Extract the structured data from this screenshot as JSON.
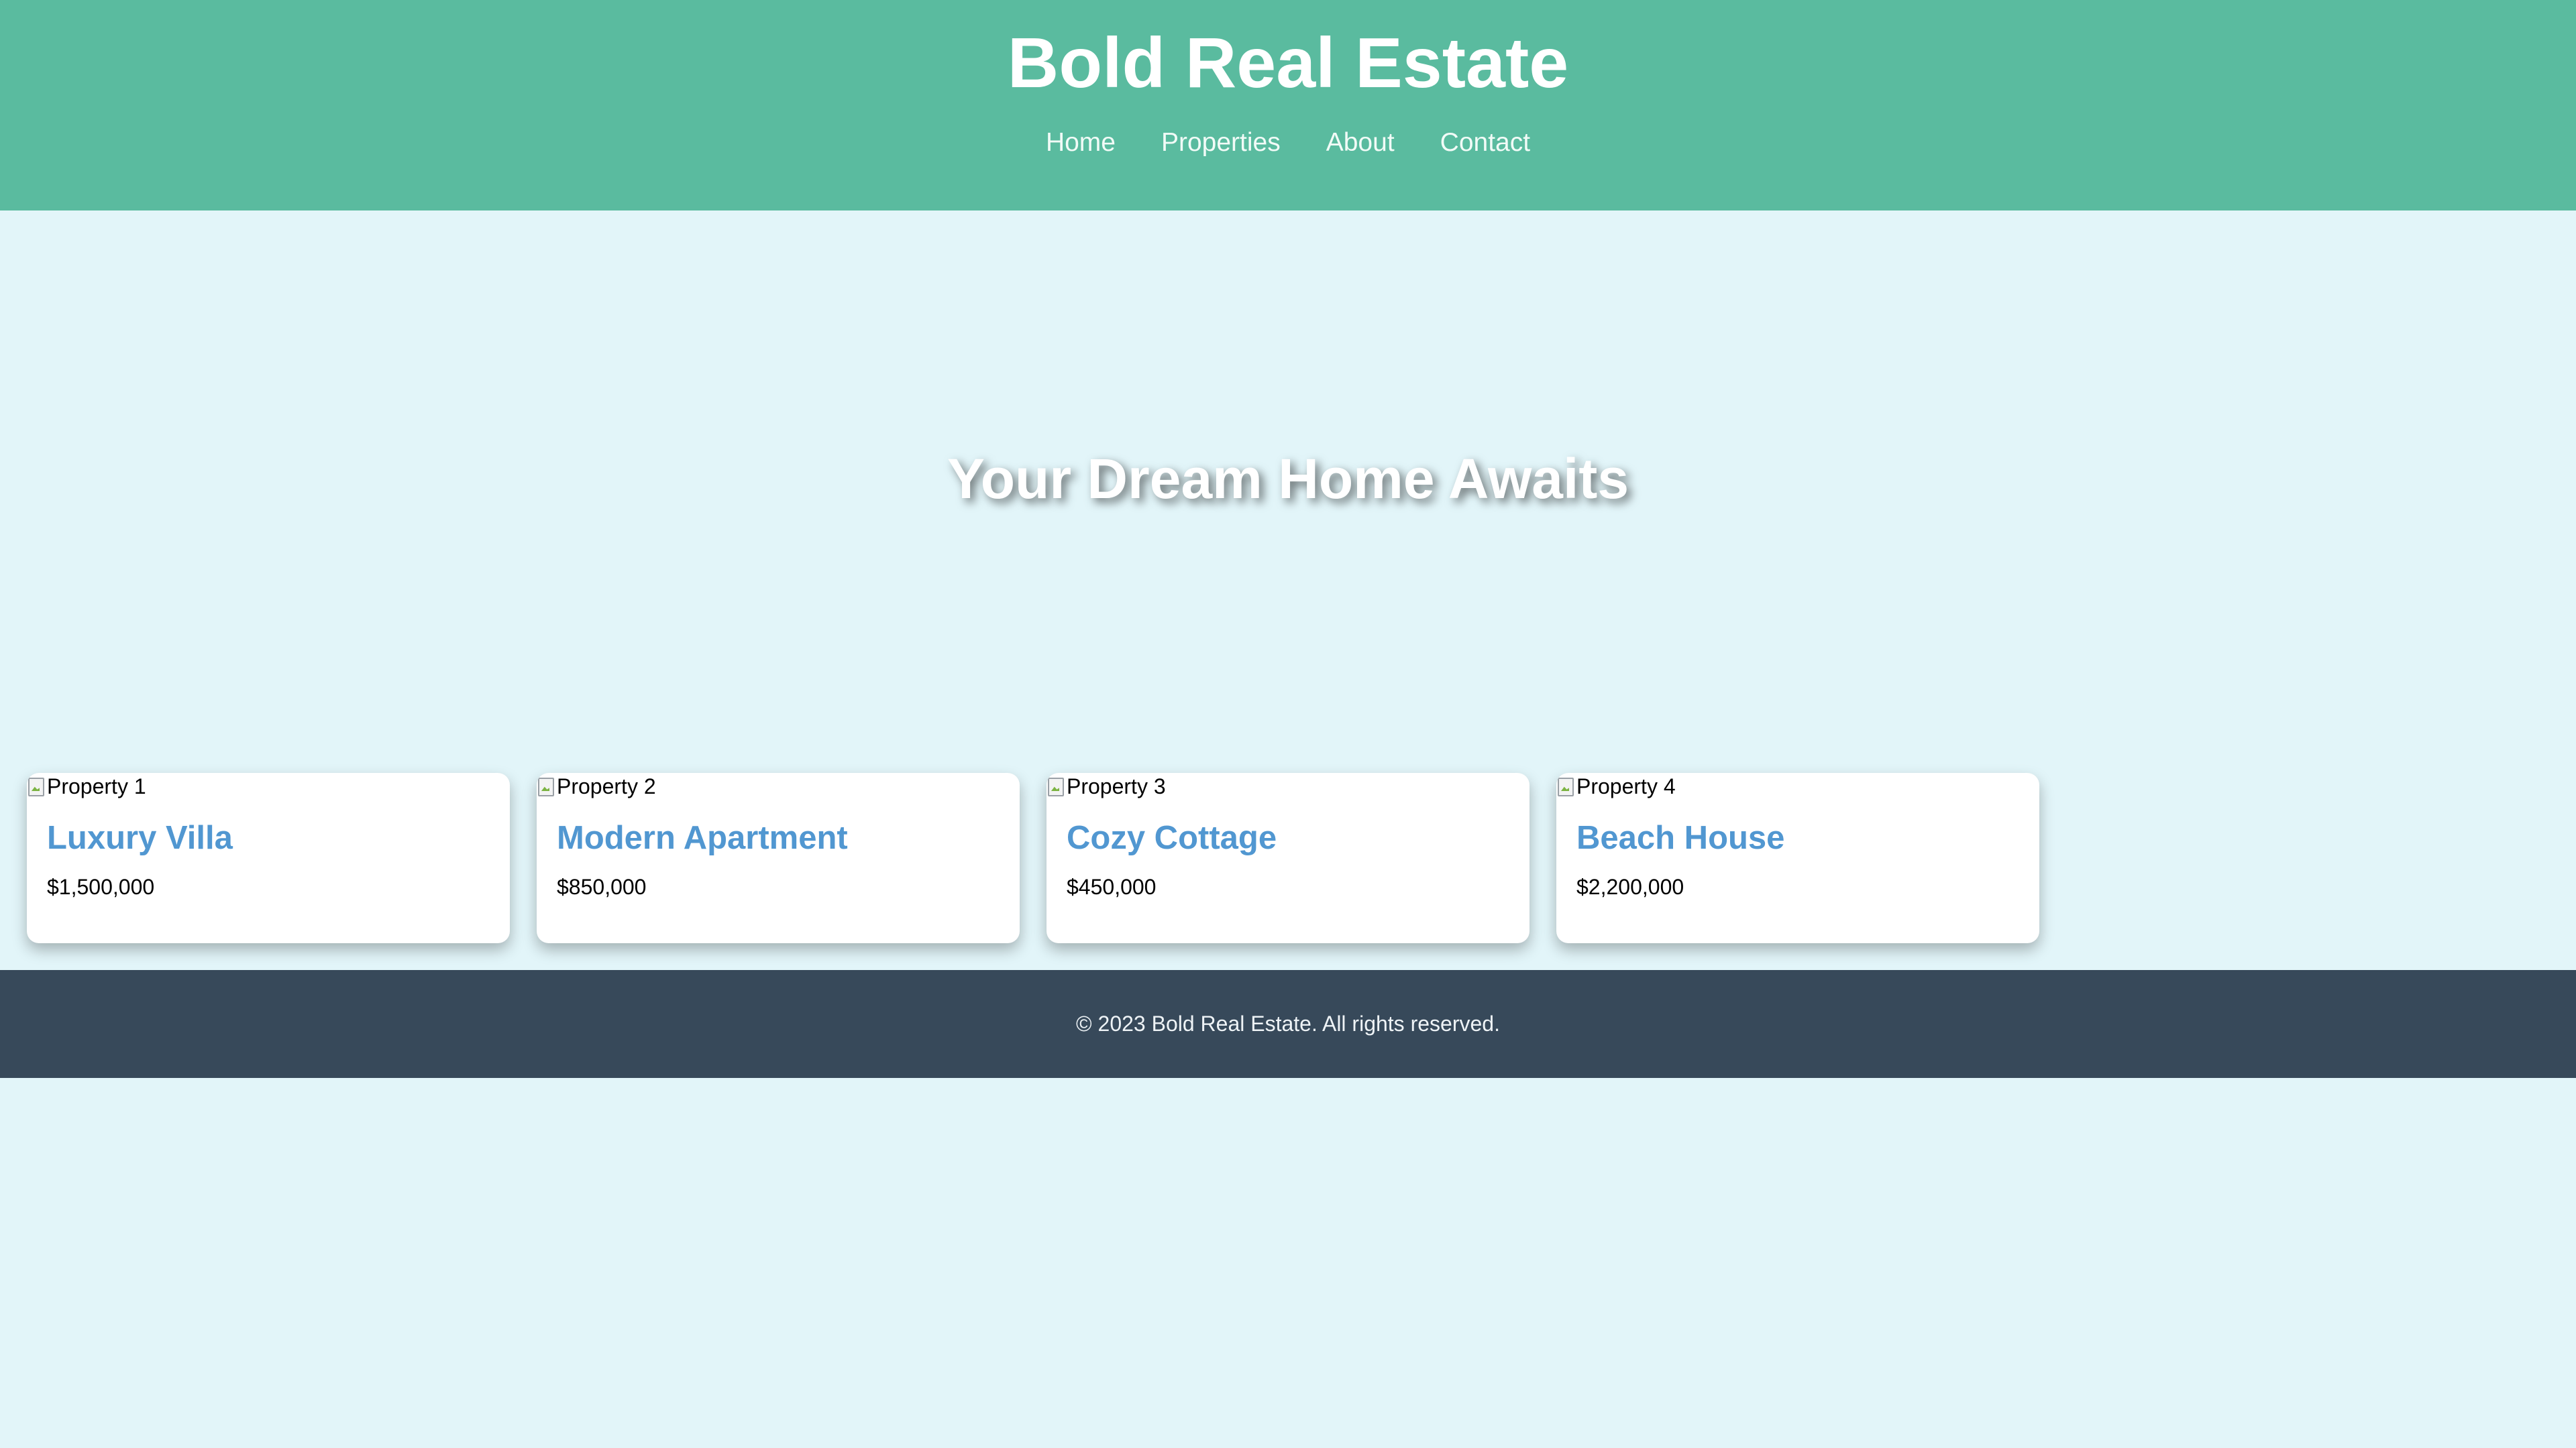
{
  "header": {
    "title": "Bold Real Estate",
    "nav": [
      {
        "label": "Home"
      },
      {
        "label": "Properties"
      },
      {
        "label": "About"
      },
      {
        "label": "Contact"
      }
    ]
  },
  "hero": {
    "title": "Your Dream Home Awaits"
  },
  "properties": [
    {
      "image_alt": "Property 1",
      "title": "Luxury Villa",
      "price": "$1,500,000"
    },
    {
      "image_alt": "Property 2",
      "title": "Modern Apartment",
      "price": "$850,000"
    },
    {
      "image_alt": "Property 3",
      "title": "Cozy Cottage",
      "price": "$450,000"
    },
    {
      "image_alt": "Property 4",
      "title": "Beach House",
      "price": "$2,200,000"
    }
  ],
  "footer": {
    "text": "© 2023 Bold Real Estate. All rights reserved."
  },
  "colors": {
    "header_bg": "#5abb9f",
    "page_bg": "#e2f5f9",
    "card_title": "#5197d1",
    "footer_bg": "#37495a"
  },
  "icons": {
    "broken_image": "broken-image-icon"
  }
}
